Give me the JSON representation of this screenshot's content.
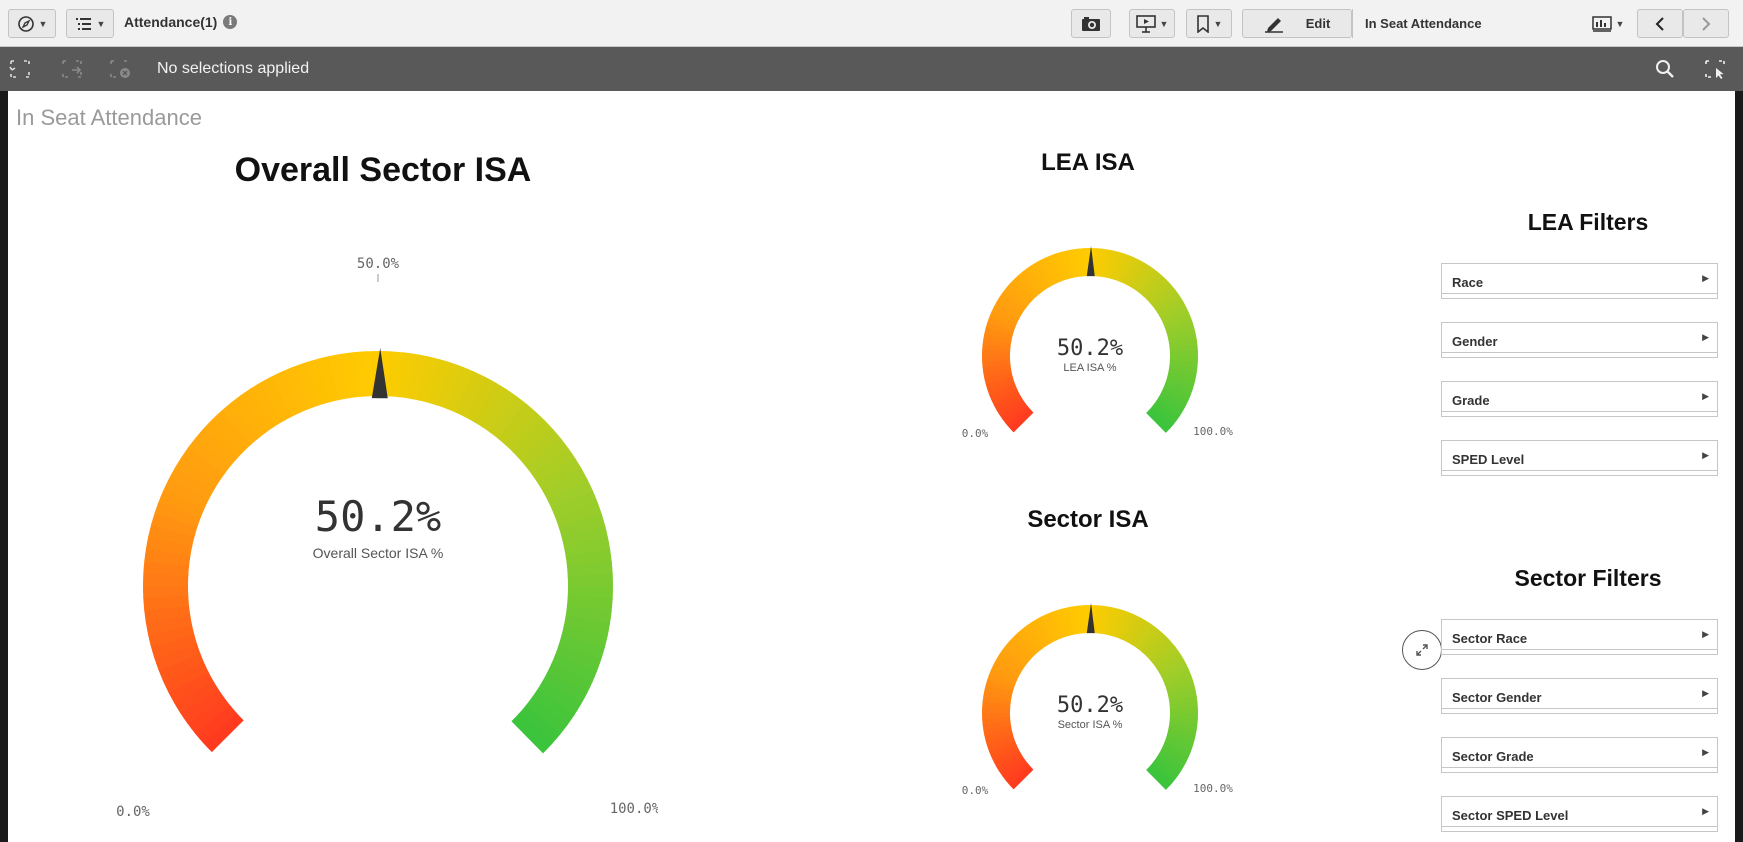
{
  "toolbar": {
    "app_title": "Attendance(1)",
    "info_icon": "i",
    "edit_label": "Edit",
    "sheet_name": "In Seat Attendance"
  },
  "selections": {
    "status_text": "No selections applied"
  },
  "sheet": {
    "title": "In Seat Attendance"
  },
  "gauges": {
    "overall": {
      "title": "Overall Sector ISA",
      "value_text": "50.2%",
      "value": 50.2,
      "measure_label": "Overall Sector ISA %",
      "min_label": "0.0%",
      "max_label": "100.0%",
      "mid_label": "50.0%"
    },
    "lea": {
      "title": "LEA ISA",
      "value_text": "50.2%",
      "value": 50.2,
      "measure_label": "LEA ISA %",
      "min_label": "0.0%",
      "max_label": "100.0%"
    },
    "sector": {
      "title": "Sector ISA",
      "value_text": "50.2%",
      "value": 50.2,
      "measure_label": "Sector ISA %",
      "min_label": "0.0%",
      "max_label": "100.0%"
    }
  },
  "gauge_colors": {
    "low": "#ff3b1f",
    "mid_low": "#ff9a10",
    "mid": "#ffcc00",
    "mid_high": "#9ccd2a",
    "high": "#3cc43c",
    "needle": "#333333"
  },
  "lea_filters": {
    "heading": "LEA Filters",
    "items": [
      "Race",
      "Gender",
      "Grade",
      "SPED Level"
    ]
  },
  "sector_filters": {
    "heading": "Sector Filters",
    "items": [
      "Sector Race",
      "Sector Gender",
      "Sector Grade",
      "Sector SPED Level"
    ]
  },
  "icons": {
    "navigation": "compass-icon",
    "sheets": "list-icon",
    "snapshot": "camera-icon",
    "presentation": "presentation-icon",
    "bookmark": "bookmark-icon",
    "edit": "pencil-icon",
    "sheet_menu": "sheet-grid-icon",
    "previous": "chevron-left-icon",
    "next": "chevron-right-icon",
    "search": "search-icon",
    "selections_tool": "selection-tool-icon",
    "expand": "expand-icon"
  }
}
